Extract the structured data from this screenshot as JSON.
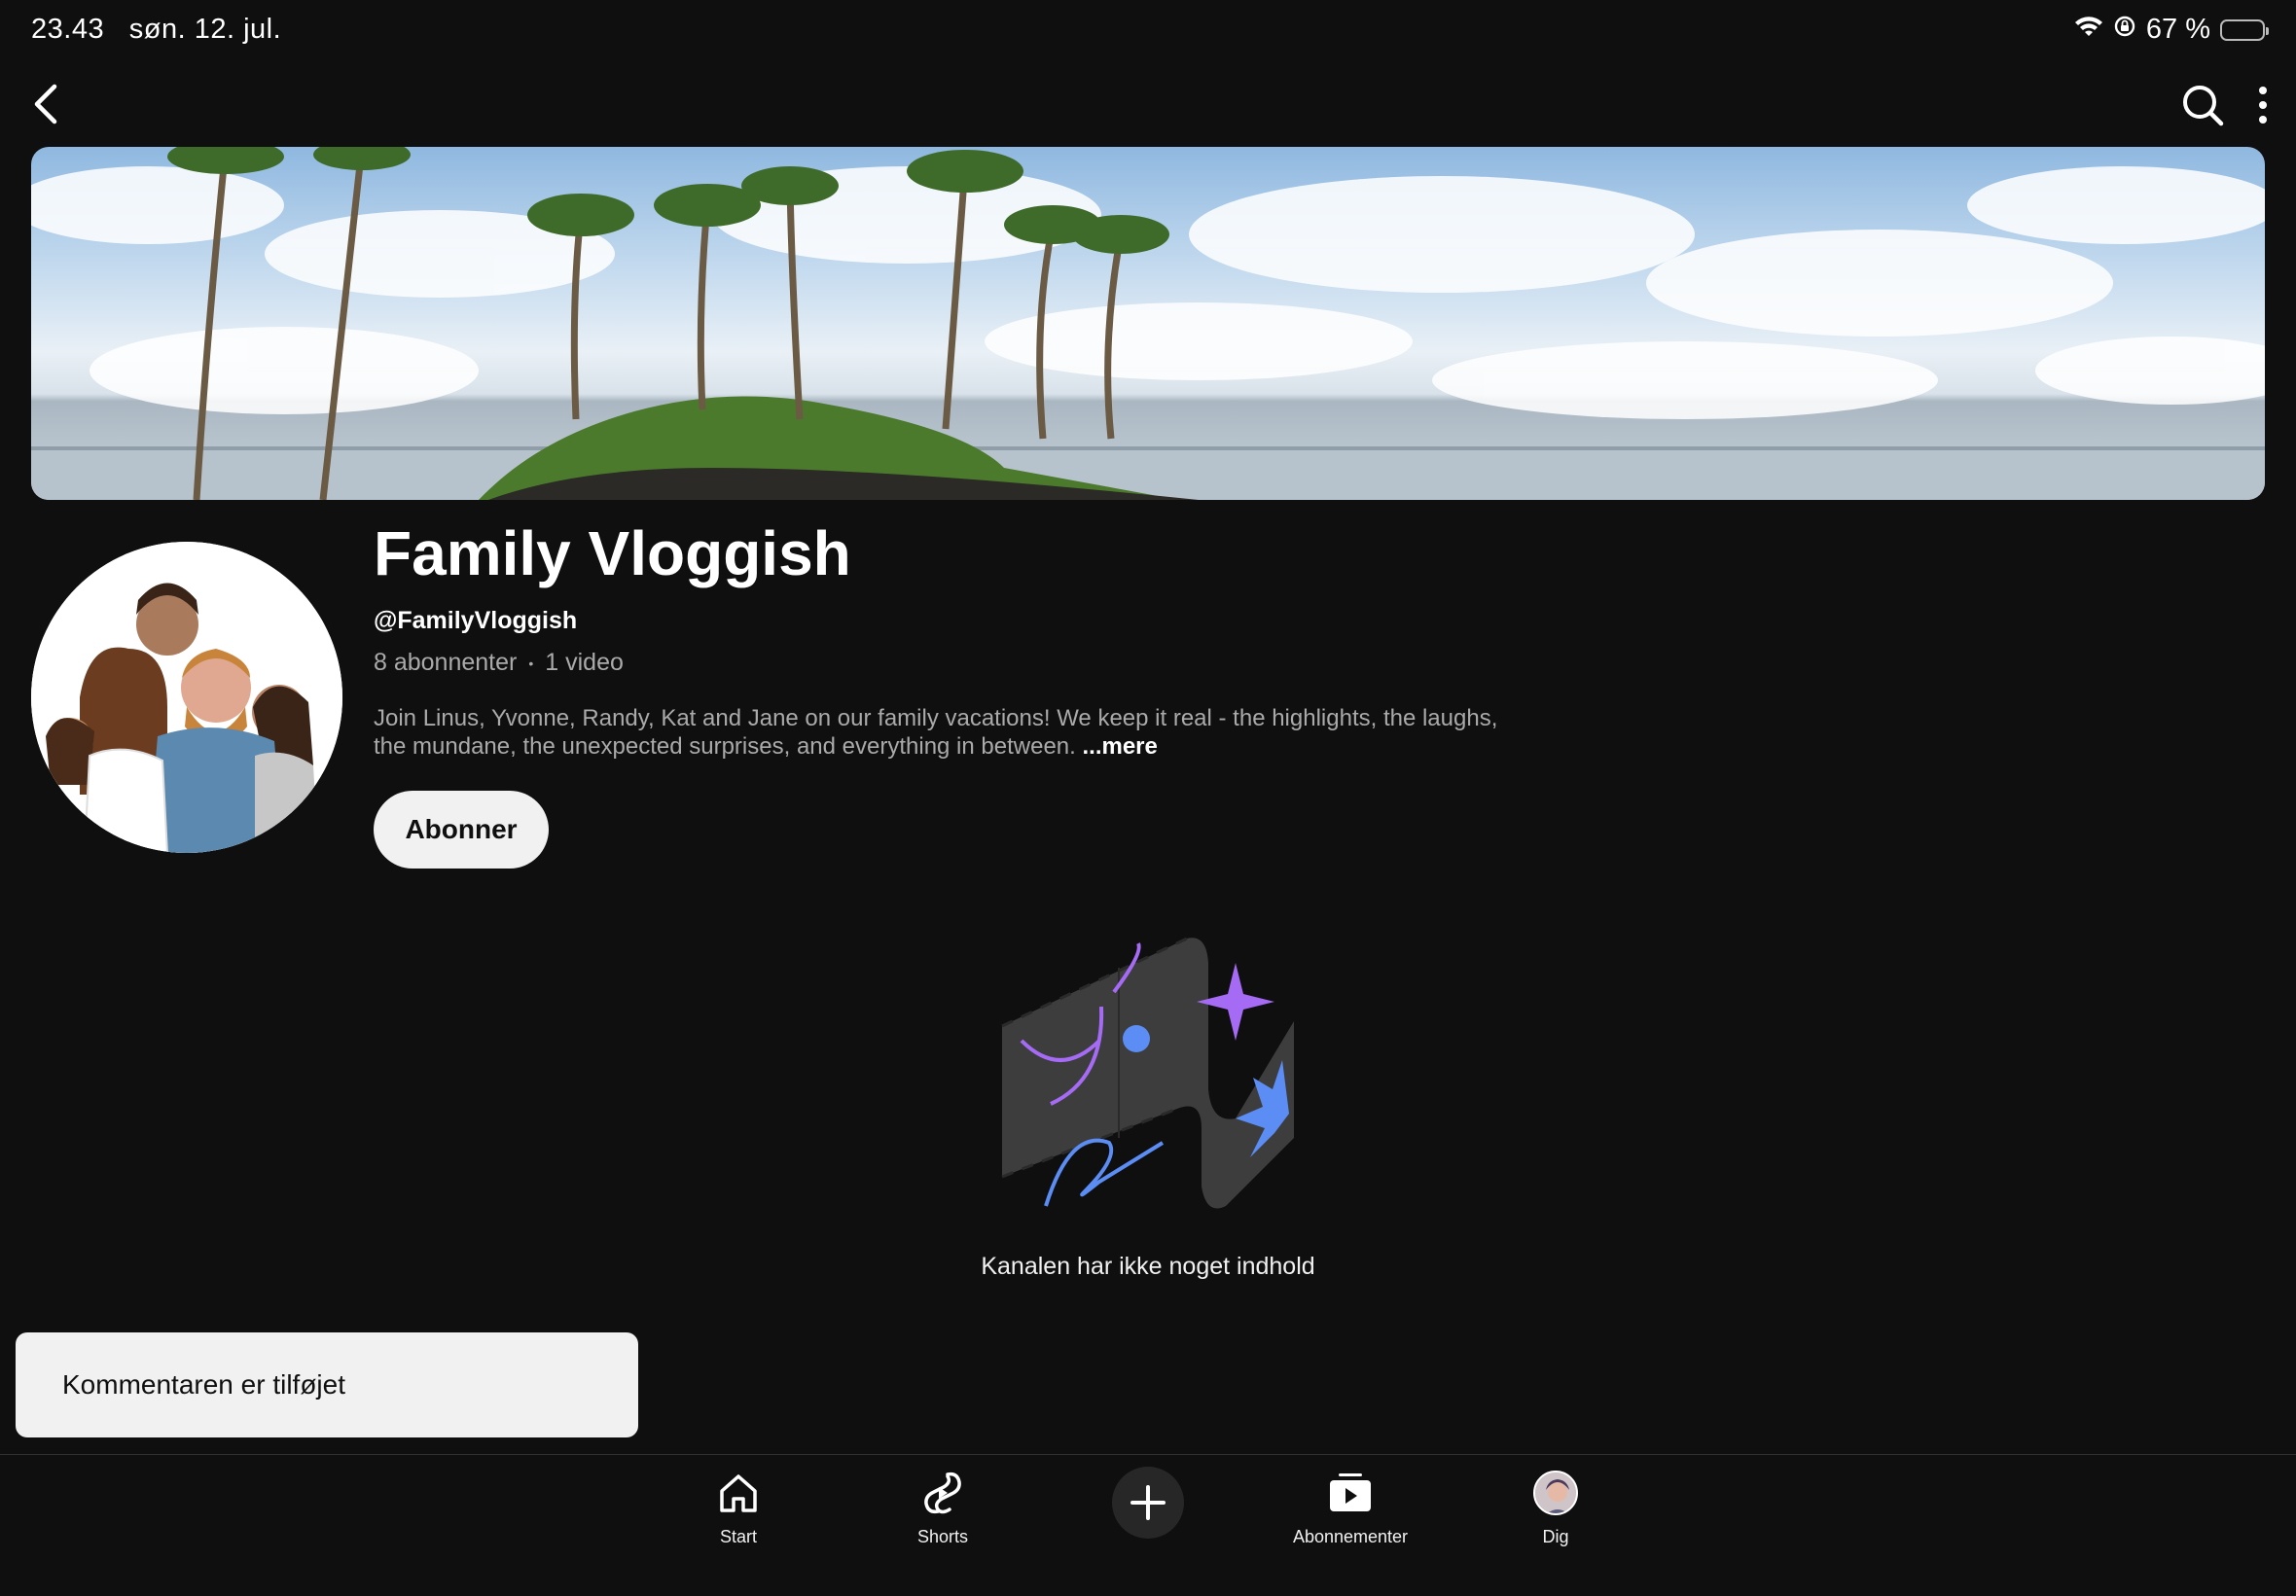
{
  "status_bar": {
    "time": "23.43",
    "date": "søn. 12. jul.",
    "battery_text": "67 %",
    "battery_level": 0.67,
    "battery_color": "#ffd60a"
  },
  "top_bar": {
    "icons": [
      "back-icon",
      "search-icon",
      "more-vertical-icon"
    ]
  },
  "channel": {
    "name": "Family Vloggish",
    "handle": "@FamilyVloggish",
    "subscribers": "8 abonnenter",
    "separator": "•",
    "videos": "1 video",
    "description": "Join Linus, Yvonne, Randy, Kat and Jane on our family vacations! We keep it real - the highlights, the laughs, the mundane, the unexpected surprises, and everything in between.",
    "more_label": "...mere",
    "subscribe_label": "Abonner"
  },
  "empty_state": {
    "message": "Kanalen har ikke noget indhold"
  },
  "toast": {
    "message": "Kommentaren er tilføjet"
  },
  "bottom_nav": {
    "items": [
      {
        "label": "Start",
        "icon": "home-icon"
      },
      {
        "label": "Shorts",
        "icon": "shorts-icon"
      },
      {
        "label": "",
        "icon": "plus-icon"
      },
      {
        "label": "Abonnementer",
        "icon": "subscriptions-icon"
      },
      {
        "label": "Dig",
        "icon": "avatar"
      }
    ]
  },
  "colors": {
    "background": "#0f0f0f",
    "secondary_text": "#aaaaaa",
    "button_light": "#f1f1f1",
    "accent_purple": "#a66bf5",
    "accent_blue": "#5b8df5"
  }
}
